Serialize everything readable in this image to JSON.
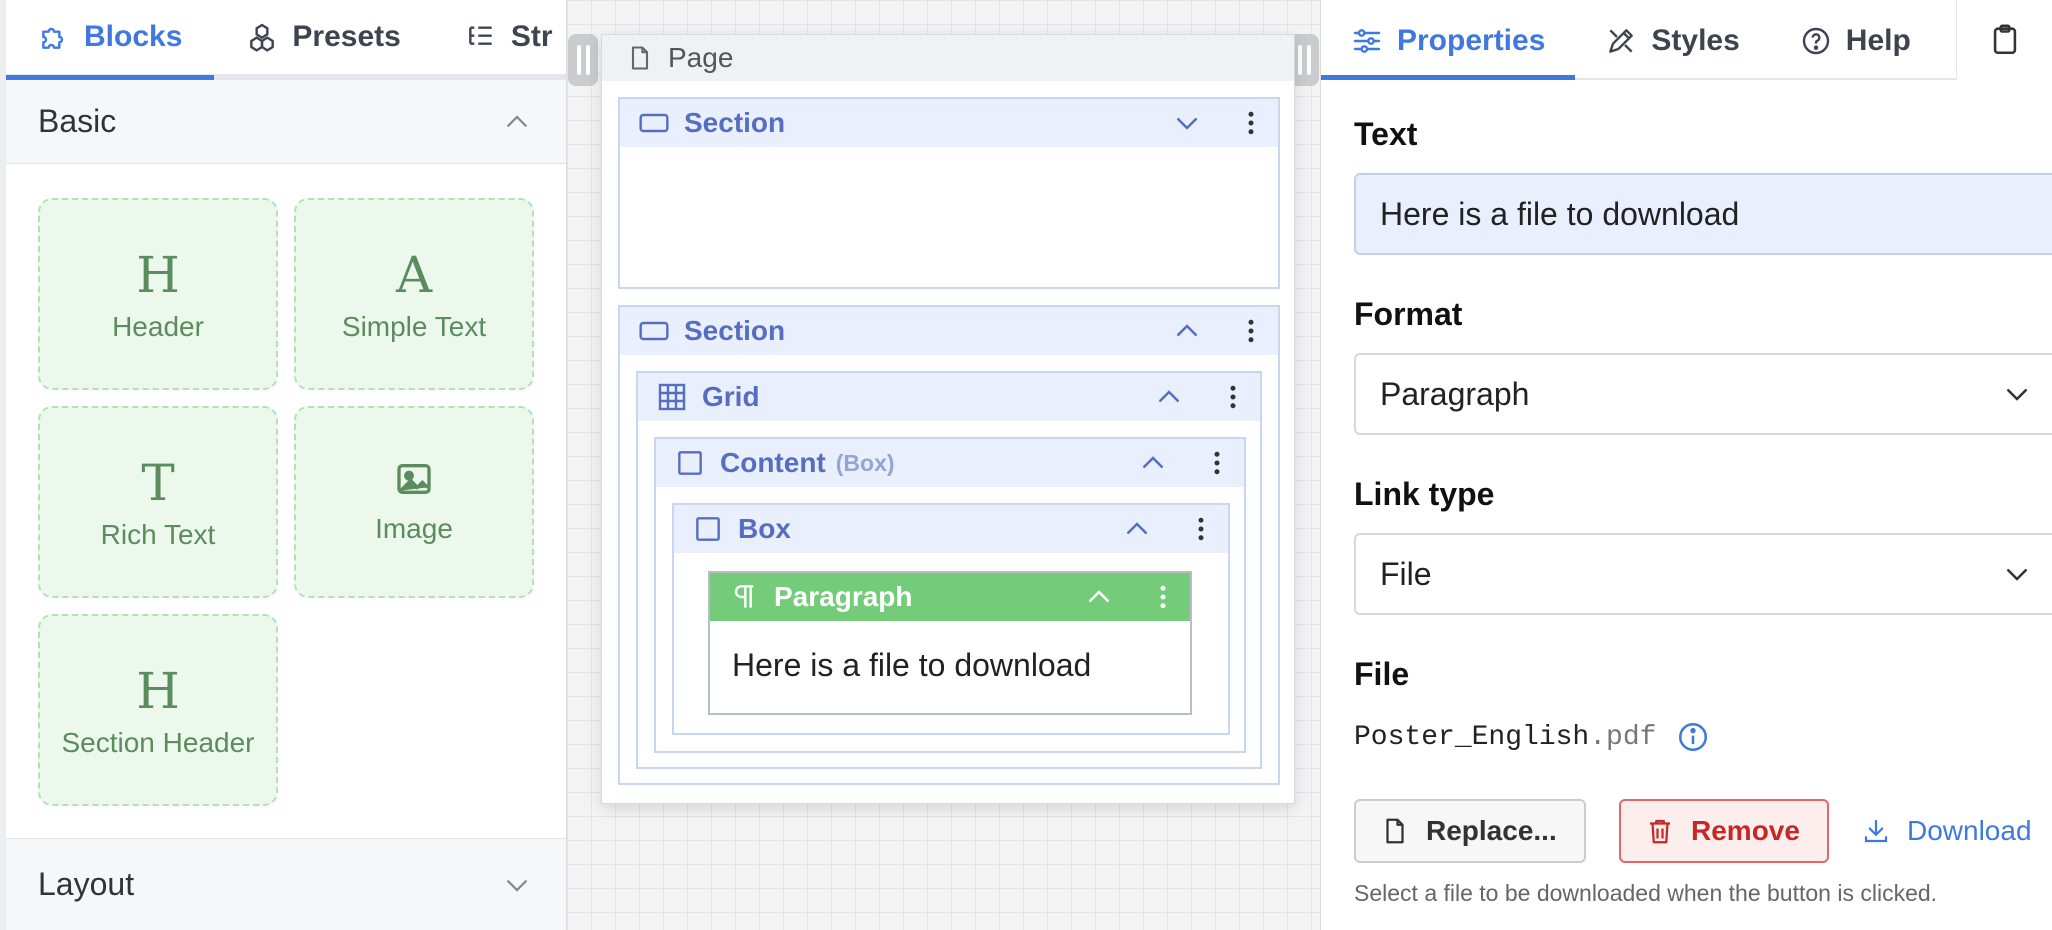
{
  "left_panel": {
    "tabs": [
      {
        "label": "Blocks",
        "active": true
      },
      {
        "label": "Presets",
        "active": false
      },
      {
        "label": "Str",
        "active": false
      }
    ],
    "basic_section": {
      "title": "Basic",
      "expanded": true
    },
    "blocks": [
      {
        "glyph": "H",
        "label": "Header"
      },
      {
        "glyph": "A",
        "label": "Simple Text"
      },
      {
        "glyph": "T",
        "label": "Rich Text"
      },
      {
        "glyph": "",
        "label": "Image",
        "icon": "image-icon"
      },
      {
        "glyph": "H",
        "label": "Section Header"
      }
    ],
    "layout_section": {
      "title": "Layout",
      "expanded": false
    }
  },
  "canvas": {
    "page_title": "Page",
    "nodes": {
      "section1": {
        "label": "Section"
      },
      "section2": {
        "label": "Section"
      },
      "grid": {
        "label": "Grid"
      },
      "content": {
        "label": "Content",
        "sub": "(Box)"
      },
      "box": {
        "label": "Box"
      },
      "paragraph": {
        "label": "Paragraph",
        "text": "Here is a file to download"
      }
    }
  },
  "right_panel": {
    "tabs": [
      {
        "label": "Properties",
        "active": true
      },
      {
        "label": "Styles",
        "active": false
      },
      {
        "label": "Help",
        "active": false
      }
    ],
    "text_label": "Text",
    "text_value": "Here is a file to download",
    "format_label": "Format",
    "format_value": "Paragraph",
    "link_type_label": "Link type",
    "link_type_value": "File",
    "file_label": "File",
    "file_name": "Poster_English",
    "file_ext": ".pdf",
    "replace_label": "Replace...",
    "remove_label": "Remove",
    "download_label": "Download",
    "help_text": "Select a file to be downloaded when the button is clicked."
  },
  "colors": {
    "accent": "#3f79e0",
    "block_green": "#5a8c5d",
    "paragraph_header": "#74cc7a",
    "node_header": "#e9effc",
    "danger": "#c62828"
  }
}
